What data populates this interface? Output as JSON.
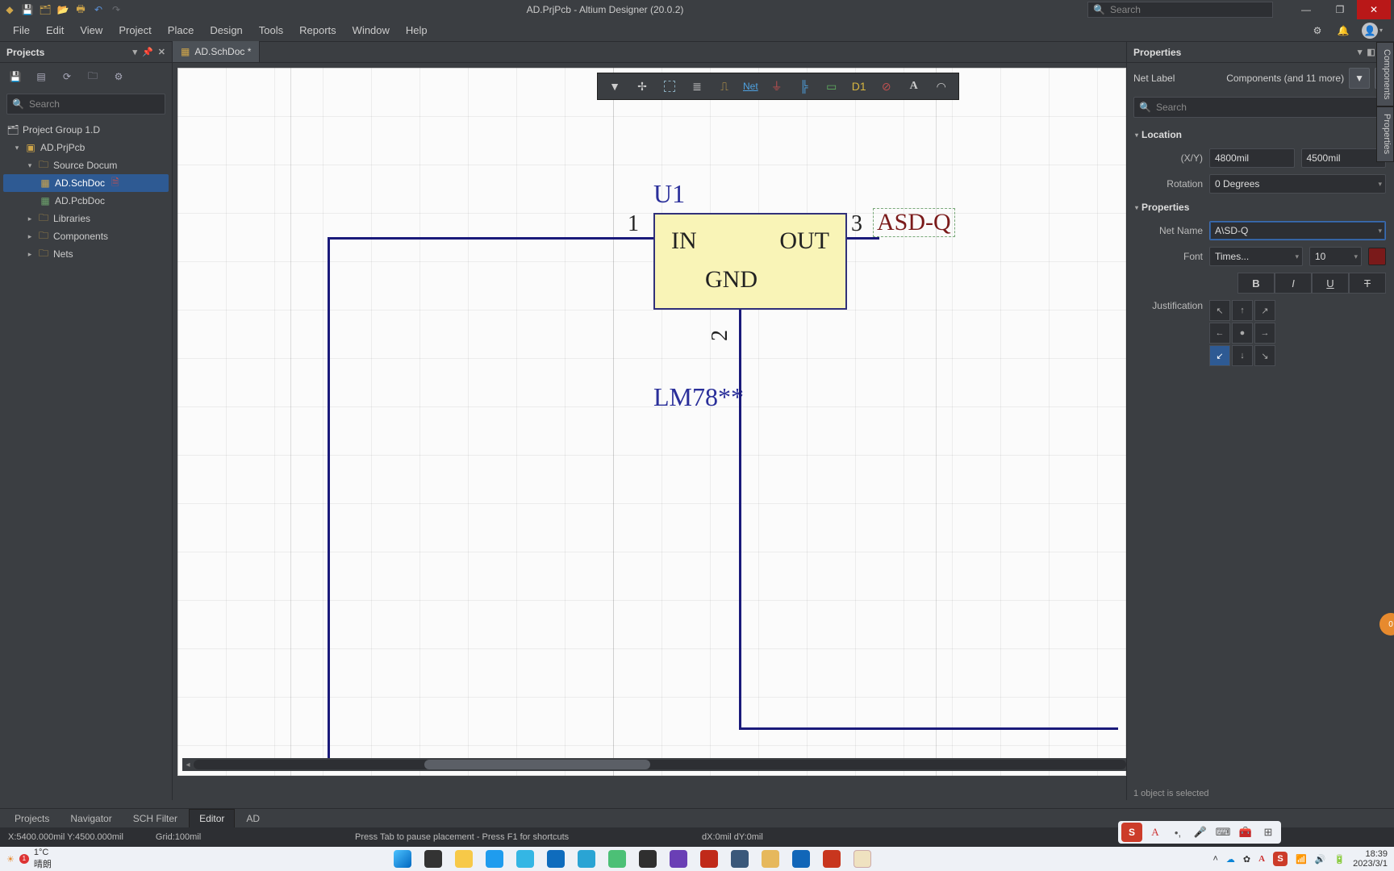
{
  "title": "AD.PrjPcb - Altium Designer (20.0.2)",
  "search_placeholder": "Search",
  "menus": [
    "File",
    "Edit",
    "View",
    "Project",
    "Place",
    "Design",
    "Tools",
    "Reports",
    "Window",
    "Help"
  ],
  "projects_panel": {
    "title": "Projects",
    "search_placeholder": "Search",
    "tree": {
      "group": "Project Group 1.D",
      "project": "AD.PrjPcb",
      "source_folder": "Source Docum",
      "files": [
        "AD.SchDoc",
        "AD.PcbDoc"
      ],
      "folders": [
        "Libraries",
        "Components",
        "Nets"
      ]
    }
  },
  "doc_tab": "AD.SchDoc *",
  "sch_toolbar_net": "Net",
  "schematic": {
    "designator": "U1",
    "pins": {
      "in": "IN",
      "out": "OUT",
      "gnd": "GND",
      "p1": "1",
      "p2": "2",
      "p3": "3"
    },
    "part_comment": "LM78**",
    "net_label_selected": "ASD-Q"
  },
  "bottom_tabs": [
    "Projects",
    "Navigator",
    "SCH Filter",
    "Editor",
    "AD"
  ],
  "status": {
    "coords": "X:5400.000mil Y:4500.000mil",
    "grid": "Grid:100mil",
    "hint": "Press Tab to pause placement - Press F1 for shortcuts",
    "delta": "dX:0mil dY:0mil"
  },
  "properties_panel": {
    "title": "Properties",
    "object_type": "Net Label",
    "filter_scope": "Components (and 11 more)",
    "search_placeholder": "Search",
    "sections": {
      "location": "Location",
      "props": "Properties"
    },
    "location": {
      "xy_label": "(X/Y)",
      "x": "4800mil",
      "y": "4500mil",
      "rotation_label": "Rotation",
      "rotation": "0 Degrees"
    },
    "props": {
      "net_name_label": "Net Name",
      "net_name": "A\\SD-Q",
      "font_label": "Font",
      "font_family": "Times...",
      "font_size": "10",
      "justification_label": "Justification"
    },
    "selection_hint": "1 object is selected"
  },
  "side_tabs": [
    "Components",
    "Properties"
  ],
  "taskbar": {
    "temp": "1°C",
    "weather": "晴朗",
    "time": "18:39",
    "date": "2023/3/1"
  }
}
